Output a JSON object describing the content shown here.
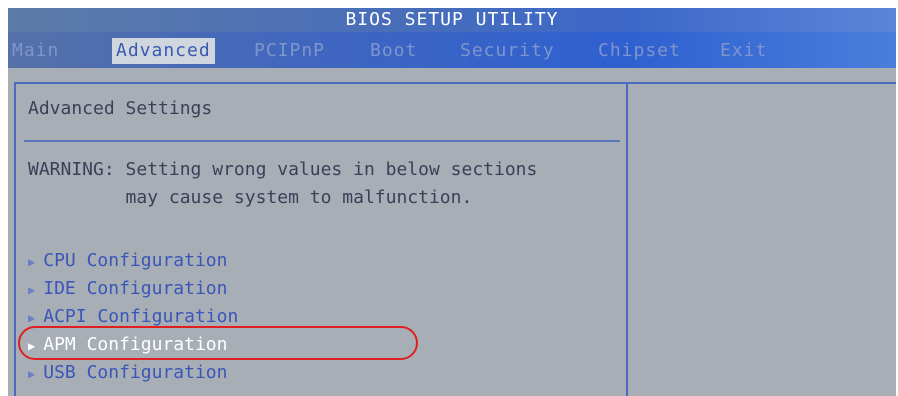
{
  "title": "BIOS SETUP UTILITY",
  "tabs": [
    {
      "label": "Main"
    },
    {
      "label": "Advanced"
    },
    {
      "label": "PCIPnP"
    },
    {
      "label": "Boot"
    },
    {
      "label": "Security"
    },
    {
      "label": "Chipset"
    },
    {
      "label": "Exit"
    }
  ],
  "active_tab": "Advanced",
  "panel": {
    "heading": "Advanced Settings",
    "warning_line1": "WARNING: Setting wrong values in below sections",
    "warning_line2": "         may cause system to malfunction."
  },
  "items": [
    {
      "label": "CPU Configuration"
    },
    {
      "label": "IDE Configuration"
    },
    {
      "label": "ACPI Configuration"
    },
    {
      "label": "APM Configuration"
    },
    {
      "label": "USB Configuration"
    }
  ],
  "selected_item": "APM Configuration",
  "icons": {
    "submenu": "triangle-right-icon"
  },
  "colors": {
    "highlight_ring": "#e02020",
    "background": "#a7aeb6",
    "accent": "#3f66c0"
  }
}
